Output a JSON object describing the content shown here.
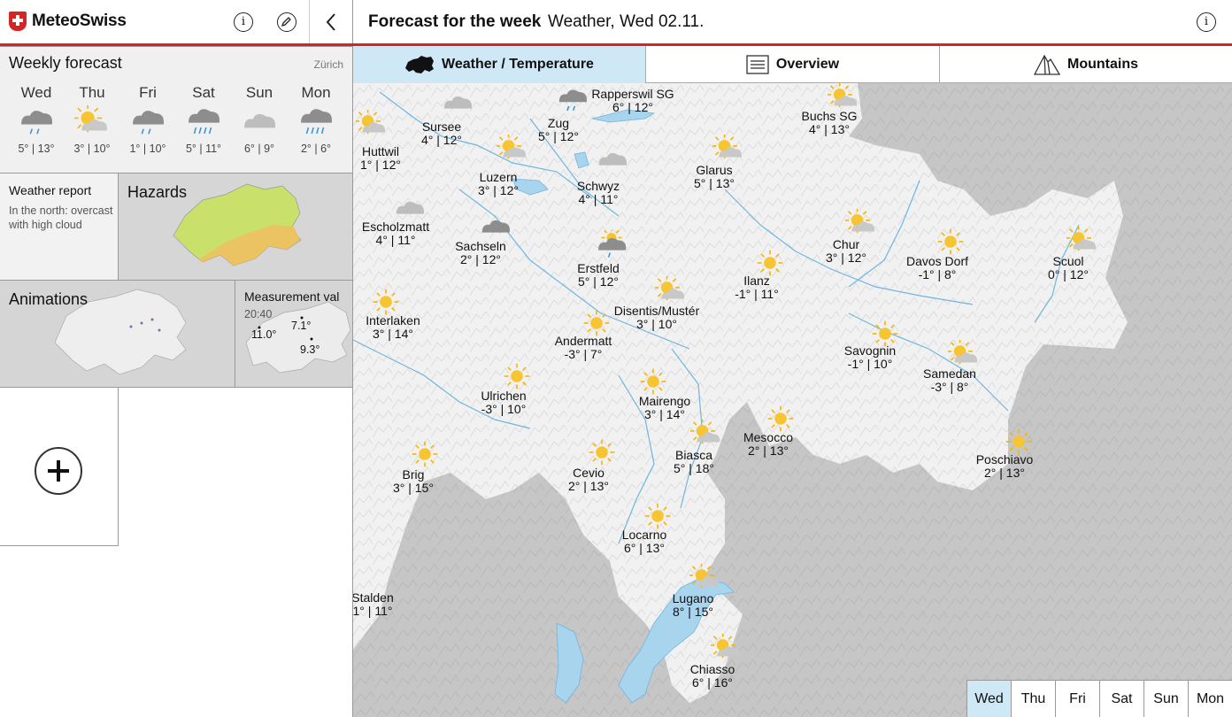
{
  "app": {
    "name": "MeteoSwiss"
  },
  "weekly": {
    "title": "Weekly forecast",
    "location": "Zürich",
    "days": [
      {
        "name": "Wed",
        "icon": "rain-cloud-icon",
        "temps": "5° | 13°"
      },
      {
        "name": "Thu",
        "icon": "sun-cloud-icon",
        "temps": "3° | 10°"
      },
      {
        "name": "Fri",
        "icon": "rain-cloud-icon",
        "temps": "1° | 10°"
      },
      {
        "name": "Sat",
        "icon": "heavy-rain-icon",
        "temps": "5° | 11°"
      },
      {
        "name": "Sun",
        "icon": "cloud-icon",
        "temps": "6° | 9°"
      },
      {
        "name": "Mon",
        "icon": "heavy-rain-icon",
        "temps": "2° | 6°"
      }
    ]
  },
  "report": {
    "title": "Weather report",
    "text": "In the north: overcast with high cloud"
  },
  "hazards": {
    "title": "Hazards"
  },
  "animations": {
    "title": "Animations"
  },
  "measurements": {
    "title": "Measurement val",
    "time": "20:40",
    "values": [
      "7.1°",
      "11.0°",
      "9.3°"
    ]
  },
  "header": {
    "title": "Forecast for the week",
    "subtitle": "Weather, Wed 02.11."
  },
  "tabs": [
    {
      "label": "Weather / Temperature",
      "icon": "switzerland-icon",
      "active": true
    },
    {
      "label": "Overview",
      "icon": "list-icon",
      "active": false
    },
    {
      "label": "Mountains",
      "icon": "mountain-icon",
      "active": false
    }
  ],
  "places": [
    {
      "name": "Huttwil",
      "temps": "1° | 12°",
      "icon": "sun-cloud"
    },
    {
      "name": "Sursee",
      "temps": "4° | 12°",
      "icon": "cloud"
    },
    {
      "name": "Zug",
      "temps": "5° | 12°",
      "icon": "rain-cloud"
    },
    {
      "name": "Rapperswil SG",
      "temps": "6° | 12°",
      "icon": ""
    },
    {
      "name": "Buchs SG",
      "temps": "4° | 13°",
      "icon": "sun-cloud"
    },
    {
      "name": "Luzern",
      "temps": "3° | 12°",
      "icon": "sun-cloud"
    },
    {
      "name": "Schwyz",
      "temps": "4° | 11°",
      "icon": "cloud"
    },
    {
      "name": "Glarus",
      "temps": "5° | 13°",
      "icon": "sun-cloud"
    },
    {
      "name": "Escholzmatt",
      "temps": "4° | 11°",
      "icon": "cloud"
    },
    {
      "name": "Sachseln",
      "temps": "2° | 12°",
      "icon": "dark-cloud"
    },
    {
      "name": "Erstfeld",
      "temps": "5° | 12°",
      "icon": "rain-sun"
    },
    {
      "name": "Chur",
      "temps": "3° | 12°",
      "icon": "sun-cloud"
    },
    {
      "name": "Davos Dorf",
      "temps": "-1° | 8°",
      "icon": "sun"
    },
    {
      "name": "Scuol",
      "temps": "0° | 12°",
      "icon": "sun-cloud"
    },
    {
      "name": "Ilanz",
      "temps": "-1° | 11°",
      "icon": "sun"
    },
    {
      "name": "Interlaken",
      "temps": "3° | 14°",
      "icon": "sun"
    },
    {
      "name": "Disentis/Mustér",
      "temps": "3° | 10°",
      "icon": "sun-cloud"
    },
    {
      "name": "Andermatt",
      "temps": "-3° | 7°",
      "icon": "sun"
    },
    {
      "name": "Savognin",
      "temps": "-1° | 10°",
      "icon": "sun"
    },
    {
      "name": "Samedan",
      "temps": "-3° | 8°",
      "icon": "sun-cloud"
    },
    {
      "name": "Ulrichen",
      "temps": "-3° | 10°",
      "icon": "sun"
    },
    {
      "name": "Mairengo",
      "temps": "3° | 14°",
      "icon": "sun"
    },
    {
      "name": "Mesocco",
      "temps": "2° | 13°",
      "icon": "sun"
    },
    {
      "name": "Biasca",
      "temps": "5° | 18°",
      "icon": "sun-cloud"
    },
    {
      "name": "Poschiavo",
      "temps": "2° | 13°",
      "icon": "sun"
    },
    {
      "name": "Brig",
      "temps": "3° | 15°",
      "icon": "sun"
    },
    {
      "name": "Cevio",
      "temps": "2° | 13°",
      "icon": "sun"
    },
    {
      "name": "Locarno",
      "temps": "6° | 13°",
      "icon": "sun"
    },
    {
      "name": "Lugano",
      "temps": "8° | 15°",
      "icon": "sun-cloud"
    },
    {
      "name": "Chiasso",
      "temps": "6° | 16°",
      "icon": "sun-cloud"
    },
    {
      "name": "Stalden",
      "temps": "1° | 11°",
      "icon": ""
    }
  ],
  "day_tabs": [
    {
      "label": "Wed",
      "active": true
    },
    {
      "label": "Thu",
      "active": false
    },
    {
      "label": "Fri",
      "active": false
    },
    {
      "label": "Sat",
      "active": false
    },
    {
      "label": "Sun",
      "active": false
    },
    {
      "label": "Mon",
      "active": false
    }
  ],
  "colors": {
    "accent": "#d42426",
    "active_tab": "#cfe8f6",
    "sun": "#f5b400",
    "water": "#6fb6e0"
  }
}
